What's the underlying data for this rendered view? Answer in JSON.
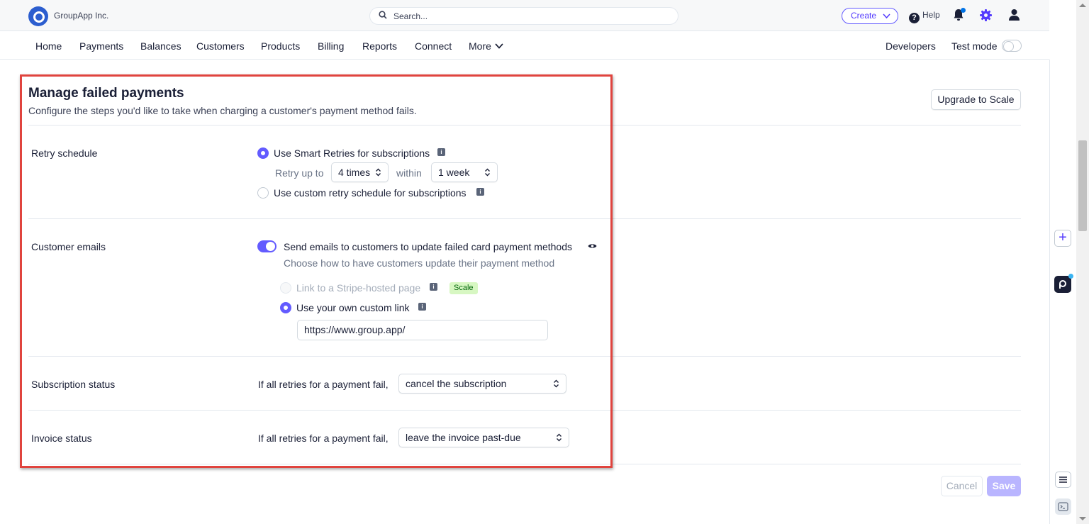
{
  "topbar": {
    "company": "GroupApp Inc.",
    "search_placeholder": "Search...",
    "create_label": "Create",
    "help_label": "Help"
  },
  "nav": {
    "items": [
      "Home",
      "Payments",
      "Balances",
      "Customers",
      "Products",
      "Billing",
      "Reports",
      "Connect",
      "More"
    ],
    "developers": "Developers",
    "test_mode": "Test mode",
    "test_mode_on": false
  },
  "page": {
    "title": "Manage failed payments",
    "subtitle": "Configure the steps you'd like to take when charging a customer's payment method fails.",
    "upgrade_label": "Upgrade to Scale"
  },
  "retry": {
    "label": "Retry schedule",
    "smart_label": "Use Smart Retries for subscriptions",
    "smart_selected": true,
    "retry_up_to": "Retry up to",
    "times_value": "4 times",
    "within": "within",
    "period_value": "1 week",
    "custom_label": "Use custom retry schedule for subscriptions"
  },
  "emails": {
    "label": "Customer emails",
    "toggle_on": true,
    "send_label": "Send emails to customers to update failed card payment methods",
    "choose_label": "Choose how to have customers update their payment method",
    "stripe_label": "Link to a Stripe-hosted page",
    "scale_badge": "Scale",
    "custom_link_label": "Use your own custom link",
    "custom_link_value": "https://www.group.app/"
  },
  "subscription": {
    "label": "Subscription status",
    "prefix": "If all retries for a payment fail,",
    "value": "cancel the subscription"
  },
  "invoice": {
    "label": "Invoice status",
    "prefix": "If all retries for a payment fail,",
    "value": "leave the invoice past-due"
  },
  "footer": {
    "cancel_label": "Cancel",
    "save_label": "Save"
  },
  "colors": {
    "accent": "#635bff",
    "highlight_border": "#e0443e",
    "badge_bg": "#d7f7c2"
  }
}
